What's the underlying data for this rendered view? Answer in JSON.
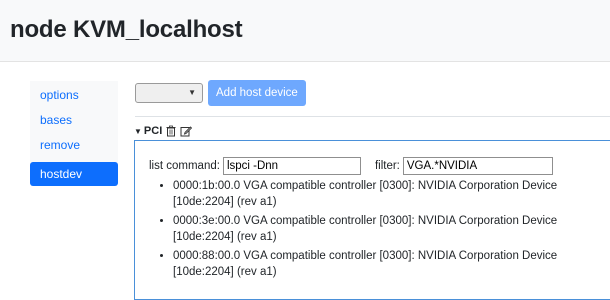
{
  "page": {
    "title": "node KVM_localhost"
  },
  "sidebar": {
    "items": [
      {
        "label": "options"
      },
      {
        "label": "bases"
      },
      {
        "label": "remove"
      },
      {
        "label": "hostdev",
        "active": true
      }
    ]
  },
  "toolbar": {
    "select_value": "",
    "add_label": "Add host device"
  },
  "pci": {
    "title": "PCI",
    "list_command_label": "list command:",
    "list_command_value": "lspci -Dnn",
    "filter_label": "filter:",
    "filter_value": "VGA.*NVIDIA",
    "devices": [
      "0000:1b:00.0 VGA compatible controller [0300]: NVIDIA Corporation Device [10de:2204] (rev a1)",
      "0000:3e:00.0 VGA compatible controller [0300]: NVIDIA Corporation Device [10de:2204] (rev a1)",
      "0000:88:00.0 VGA compatible controller [0300]: NVIDIA Corporation Device [10de:2204] (rev a1)"
    ]
  },
  "colors": {
    "accent": "#0d6efd",
    "button": "#6ea8fe",
    "panel_border": "#4a90d9"
  },
  "icons": {
    "delete": "trash-icon",
    "edit": "edit-icon",
    "collapse": "caret-down-icon"
  }
}
